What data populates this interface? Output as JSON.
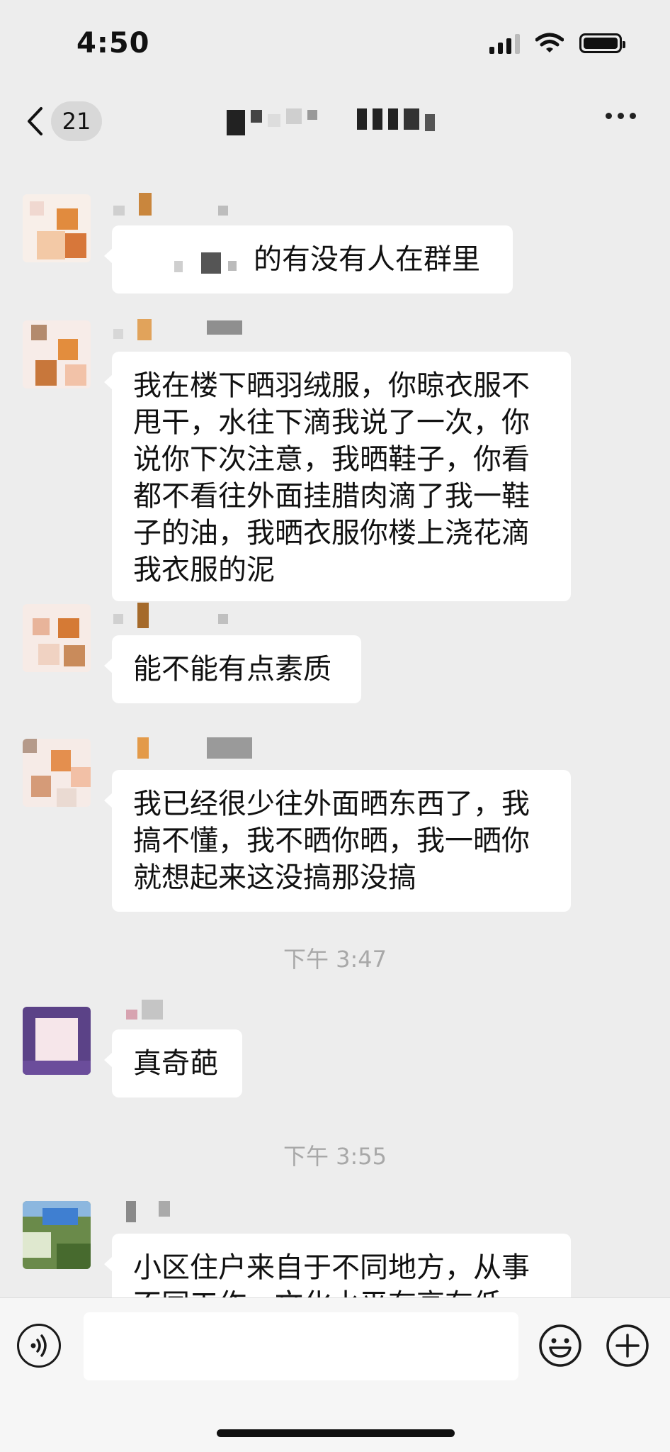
{
  "status_bar": {
    "time": "4:50",
    "signal_icon": "cellular-signal-icon",
    "wifi_icon": "wifi-icon",
    "battery_icon": "battery-icon",
    "battery_level": 1.0
  },
  "nav": {
    "back_icon": "chevron-left-icon",
    "unread_count": "21",
    "title": "",
    "more_icon": "ellipsis-icon"
  },
  "messages": [
    {
      "sender": "",
      "text": "的有没有人在群里"
    },
    {
      "sender": "",
      "text": "我在楼下晒羽绒服，你晾衣服不甩干，水往下滴我说了一次，你说你下次注意，我晒鞋子，你看都不看往外面挂腊肉滴了我一鞋子的油，我晒衣服你楼上浇花滴我衣服的泥"
    },
    {
      "sender": "",
      "text": "能不能有点素质"
    },
    {
      "sender": "",
      "text": "我已经很少往外面晒东西了，我搞不懂，我不晒你晒，我一晒你就想起来这没搞那没搞"
    },
    {
      "timestamp": "下午 3:47"
    },
    {
      "sender": "",
      "text": "真奇葩"
    },
    {
      "timestamp": "下午 3:55"
    },
    {
      "sender": "",
      "text": "小区住户来自于不同地方，从事不同工作，文化水平有高有低"
    }
  ],
  "input_bar": {
    "voice_icon": "voice-input-icon",
    "input_value": "",
    "emoji_icon": "emoji-icon",
    "plus_icon": "plus-icon"
  },
  "colors": {
    "background": "#ededed",
    "bubble": "#ffffff",
    "timestamp": "#a8a8a8",
    "badge": "#d8d8d8"
  }
}
